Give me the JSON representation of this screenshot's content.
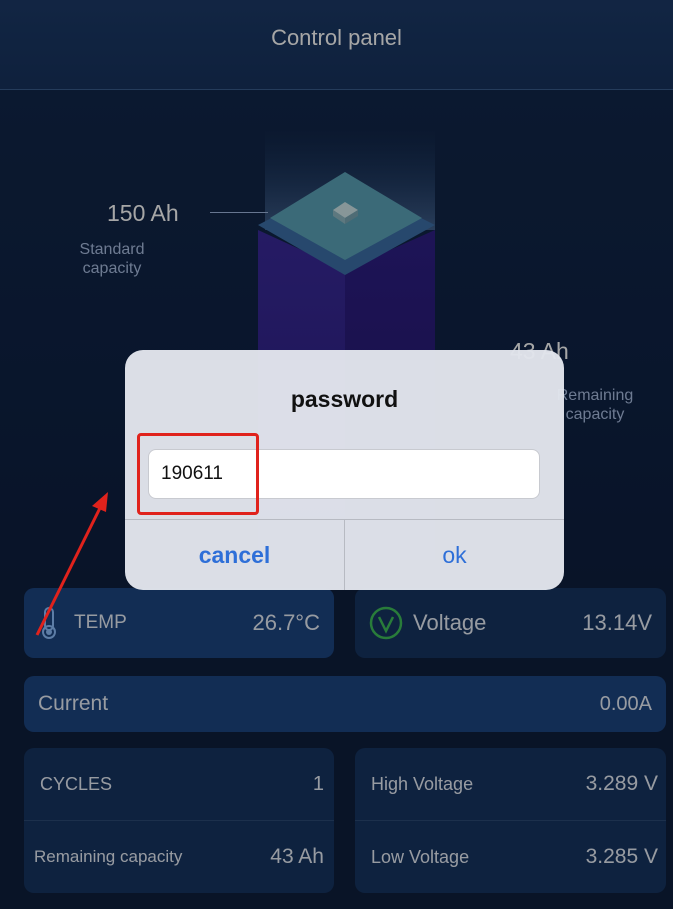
{
  "header": {
    "title": "Control panel"
  },
  "battery": {
    "standard_value": "150 Ah",
    "standard_label": "Standard capacity",
    "remaining_value": "43 Ah",
    "remaining_label": "Remaining capacity",
    "fill_fraction": 0.29
  },
  "cards": {
    "temp": {
      "label": "TEMP",
      "value": "26.7°C",
      "icon": "thermometer-icon"
    },
    "voltage": {
      "label": "Voltage",
      "value": "13.14V",
      "icon": "voltage-icon"
    },
    "current": {
      "label": "Current",
      "value": "0.00A"
    },
    "cycles": {
      "label": "CYCLES",
      "value": "1"
    },
    "remaining": {
      "label": "Remaining capacity",
      "value": "43 Ah"
    },
    "high_voltage": {
      "label": "High Voltage",
      "value": "3.289 V"
    },
    "low_voltage": {
      "label": "Low Voltage",
      "value": "3.285 V"
    }
  },
  "dialog": {
    "title": "password",
    "input_value": "190611",
    "cancel_label": "cancel",
    "ok_label": "ok"
  },
  "colors": {
    "accent_blue": "#2e6fd8",
    "annotation_red": "#e0221c",
    "voltage_green": "#3fbf5a",
    "background": "#0f1f3c"
  }
}
